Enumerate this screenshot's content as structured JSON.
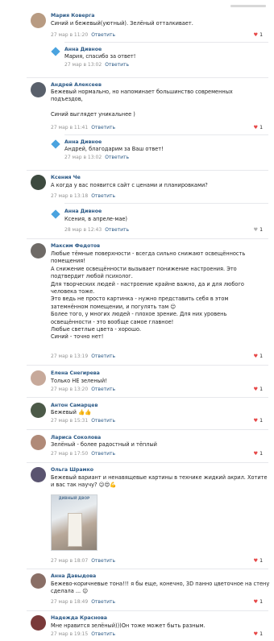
{
  "reply_label": "Ответить",
  "comments": [
    {
      "author": "Мария Коверга",
      "text": "Синий и бежевый(уютный). Зелёный отталкивает.",
      "time": "27 мар в 11:20",
      "likes": "1"
    },
    {
      "author": "Анна Дивное",
      "text": "Мария, спасибо за ответ!",
      "time": "27 мар в 13:02"
    },
    {
      "author": "Андрей Алексеев",
      "text": "Бежевый нормально, но напоминает большинство современных\nподъездов,\n\nСиний выглядет уникальнее )",
      "time": "27 мар в 11:41",
      "likes": "1"
    },
    {
      "author": "Анна Дивное",
      "text": "Андрей, благодарим за Ваш ответ!",
      "time": "27 мар в 13:02"
    },
    {
      "author": "Ксения Че",
      "text": "А когда у вас появится сайт с ценами и планировками?",
      "time": "27 мар в 13:18"
    },
    {
      "author": "Анна Дивное",
      "text": "Ксения, в апреле-мае)",
      "time": "28 мар в 12:43",
      "likes": "1"
    },
    {
      "author": "Максим Федотов",
      "text": "Любые тёмные поверхности - всегда сильно снижают освещённость\nпомещения!\nА снижение освещённости вызывает понижение настроения. Это\nподтвердит любой психолог.\nДля творческих людей - настроение крайне важно, да и для любого\nчеловека тоже.\nЭто ведь не просто картинка - нужно представить себя в этом\nзатемнённом помещении, и погулять там 😊\nБолее того, у многих людей - плохое зрение. Для них уровень\nосвещённости - это вообще самое главное!\nЛюбые светлые цвета - хорошо.\nСиний - точно нет!",
      "time": "27 мар в 13:19",
      "likes": "1"
    },
    {
      "author": "Елена Снегирева",
      "text": "Только НЕ зеленый!",
      "time": "27 мар в 13:20",
      "likes": "1"
    },
    {
      "author": "Антон Самарцев",
      "text": "Бежевый 👍👍",
      "time": "27 мар в 15:31",
      "likes": "1"
    },
    {
      "author": "Лариса Соколова",
      "text": "Зелёный - более радостный и тёплый",
      "time": "27 мар в 17:50",
      "likes": "1"
    },
    {
      "author": "Ольга Шрамко",
      "text": "Бежевый вариант и ненавящевые картины в технике жидкий акрил. Хотите\nи вас так научу? 😉😍💪",
      "time": "27 мар в 18:07",
      "likes": "1",
      "attachment": "ДИВНЫЙ\nДВОР"
    },
    {
      "author": "Анна Давыдова",
      "text": "Бежево-коричневые тона!!! я бы еще, конечно, 3D панно цветочное на стену\nсделала ... 😉",
      "time": "27 мар в 18:49",
      "likes": "1"
    },
    {
      "author": "Надежда Краснова",
      "text": "Мне нравится зелёный)))Он тоже может быть разным.",
      "time": "27 мар в 19:15",
      "likes": "1"
    }
  ],
  "colors": {
    "link": "#2a5885",
    "heart": "#e64646",
    "meta": "#939393",
    "divider": "#e7e8ec"
  },
  "icons": {
    "like": "heart-icon",
    "community_avatar": "diamond-logo-icon"
  }
}
